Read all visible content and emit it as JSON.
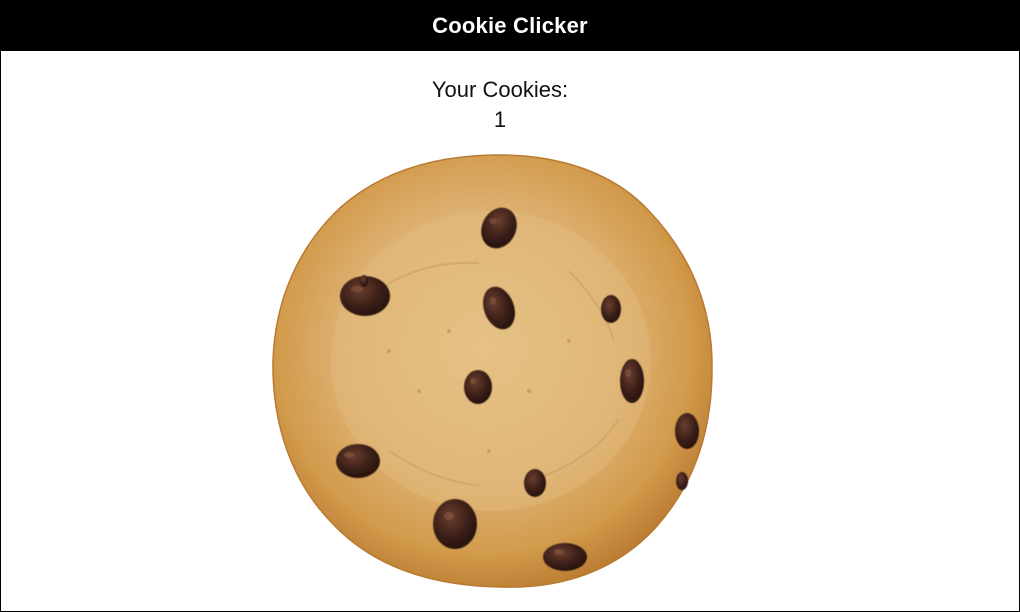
{
  "header": {
    "title": "Cookie Clicker"
  },
  "score": {
    "label": "Your Cookies:",
    "count": "1"
  },
  "cookie": {
    "icon": "chocolate-chip-cookie-icon",
    "colors": {
      "dough_edge": "#c98d3c",
      "dough_center": "#e3bb7c",
      "chip": "#3a1f17"
    }
  }
}
